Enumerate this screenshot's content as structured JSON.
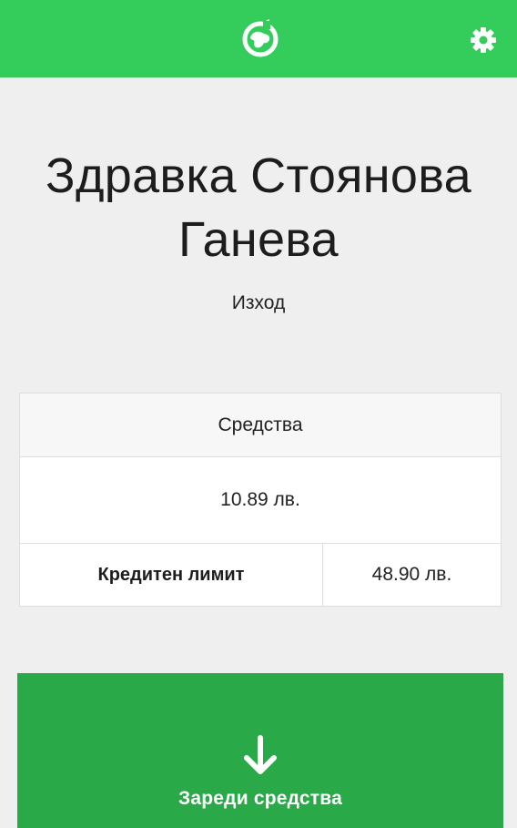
{
  "header": {
    "background_color": "#34cd5c",
    "logo_icon": "globe-refresh-icon",
    "settings_icon": "gear-icon"
  },
  "profile": {
    "name_line1": "Здравка Стоянова",
    "name_line2": "Ганева",
    "logout_label": "Изход"
  },
  "funds_card": {
    "title": "Средства",
    "balance": "10.89 лв.",
    "credit_limit_label": "Кредитен лимит",
    "credit_limit_value": "48.90 лв."
  },
  "topup_button": {
    "label": "Зареди средства",
    "icon": "arrow-down-icon",
    "background_color": "#29a947"
  }
}
